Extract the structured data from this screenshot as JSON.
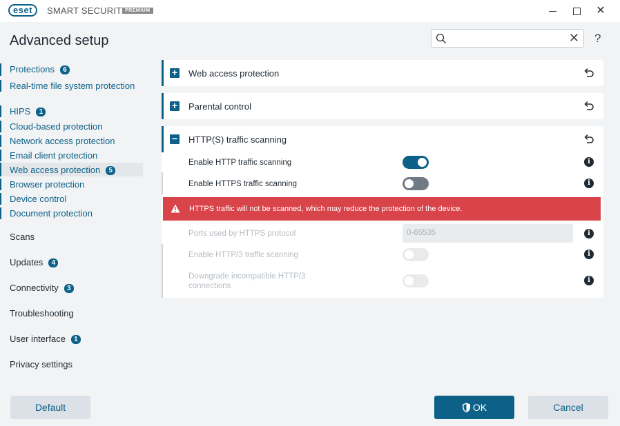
{
  "app": {
    "logo_text": "eset",
    "product_name": "SMART SECURITY",
    "edition": "PREMIUM"
  },
  "window": {
    "minimize_icon": "minimize-icon",
    "maximize_icon": "maximize-icon",
    "close_glyph": "✕"
  },
  "header": {
    "title": "Advanced setup",
    "search_placeholder": "",
    "search_value": "",
    "search_clear": "✕",
    "help": "?"
  },
  "sidebar": {
    "items": [
      {
        "label": "Protections",
        "badge": "6",
        "type": "section-link"
      },
      {
        "label": "Real-time file system protection",
        "badge": "",
        "type": "sub"
      },
      {
        "label": "HIPS",
        "badge": "1",
        "type": "sub"
      },
      {
        "label": "Cloud-based protection",
        "badge": "",
        "type": "sub"
      },
      {
        "label": "Network access protection",
        "badge": "",
        "type": "sub"
      },
      {
        "label": "Email client protection",
        "badge": "",
        "type": "sub"
      },
      {
        "label": "Web access protection",
        "badge": "5",
        "type": "sub",
        "active": true
      },
      {
        "label": "Browser protection",
        "badge": "",
        "type": "sub"
      },
      {
        "label": "Device control",
        "badge": "",
        "type": "sub"
      },
      {
        "label": "Document protection",
        "badge": "",
        "type": "sub"
      },
      {
        "label": "Scans",
        "badge": "",
        "type": "section"
      },
      {
        "label": "Updates",
        "badge": "4",
        "type": "section"
      },
      {
        "label": "Connectivity",
        "badge": "3",
        "type": "section"
      },
      {
        "label": "Troubleshooting",
        "badge": "",
        "type": "section"
      },
      {
        "label": "User interface",
        "badge": "1",
        "type": "section"
      },
      {
        "label": "Privacy settings",
        "badge": "",
        "type": "section"
      }
    ]
  },
  "panels": {
    "web_access": {
      "title": "Web access protection",
      "expand": "+"
    },
    "parental": {
      "title": "Parental control",
      "expand": "+"
    },
    "https": {
      "title": "HTTP(S) traffic scanning",
      "expand": "−",
      "settings": [
        {
          "label": "Enable HTTP traffic scanning",
          "state": "on"
        },
        {
          "label": "Enable HTTPS traffic scanning",
          "state": "off"
        }
      ],
      "warning": "HTTPS traffic will not be scanned, which may reduce the protection of the device.",
      "ports_label": "Ports used by HTTPS protocol",
      "ports_value": "0-65535",
      "http3_label": "Enable HTTP/3 traffic scanning",
      "downgrade_label": "Downgrade incompatible HTTP/3 connections",
      "info": "i"
    }
  },
  "footer": {
    "default_label": "Default",
    "ok_label": "OK",
    "cancel_label": "Cancel"
  },
  "colors": {
    "accent": "#0d6189",
    "warning": "#d9444a",
    "background": "#f2f3f4"
  }
}
